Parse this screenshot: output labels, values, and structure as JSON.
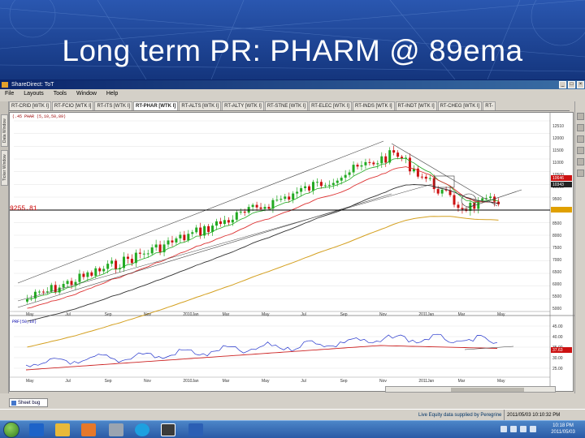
{
  "slide": {
    "title": "Long term PR: PHARM @ 89ema"
  },
  "window": {
    "title": "ShareDirect: ToT",
    "controls": [
      "_",
      "□",
      "×"
    ]
  },
  "menu": [
    "File",
    "Layouts",
    "Tools",
    "Window",
    "Help"
  ],
  "tabs": [
    {
      "label": "RT-CRID [WTK I]",
      "active": false
    },
    {
      "label": "RT-FCIO [WTK I]",
      "active": false
    },
    {
      "label": "RT-ITS [WTK I]",
      "active": false
    },
    {
      "label": "RT-PHAR [WTK I]",
      "active": true
    },
    {
      "label": "RT-ALTS [WTK I]",
      "active": false
    },
    {
      "label": "RT-ALTY [WTK I]",
      "active": false
    },
    {
      "label": "RT-STNE [WTK I]",
      "active": false
    },
    {
      "label": "RT-ELEC [WTK I]",
      "active": false
    },
    {
      "label": "RT-INDS [WTK I]",
      "active": false
    },
    {
      "label": "RT-INDT [WTK I]",
      "active": false
    },
    {
      "label": "RT-CHEG [WTK I]",
      "active": false
    },
    {
      "label": "RT-",
      "active": false
    }
  ],
  "left_dock_tabs": [
    "Data Window",
    "Ticker Window"
  ],
  "chart": {
    "header_info": "(.45 PHAR (5,10,50,89)",
    "indicator_info": "PRF(50,10)",
    "price_level_label": "9255.81",
    "x_labels": [
      "May",
      "Jul",
      "Sep",
      "Nov",
      "2010Jan",
      "Mar",
      "May",
      "Jul",
      "Sep",
      "Nov",
      "2011Jan",
      "Mar",
      "May"
    ],
    "price_axis_labels": [
      "12510",
      "12000",
      "11500",
      "11000",
      "10500",
      "10000",
      "9500",
      "9000",
      "8500",
      "8000",
      "7500",
      "7000",
      "6500",
      "6000",
      "5500",
      "5000"
    ],
    "price_axis_tags": [
      "10646",
      "10343"
    ],
    "indicator_axis_labels": [
      "45.00",
      "40.00",
      "35.00",
      "30.00",
      "25.00"
    ],
    "indicator_axis_tag": "37.63",
    "colors": {
      "up_candle": "#22aa22",
      "down_candle": "#cc1111",
      "ema_long": "#d4a020",
      "ema_mid": "#dd3333",
      "ema_short": "#333333",
      "channel": "#444444",
      "indicator": "#2233cc",
      "indicator_signal": "#cc2222",
      "level_line": "#000000"
    }
  },
  "sheet_tab": "Sheet bug",
  "status": {
    "text": "Live Equity data supplied by Peregrine",
    "datetime": "2011/05/03 10:10:32 PM"
  },
  "taskbar": {
    "time": "10:18 PM",
    "date": "2011/05/03",
    "apps": [
      "windows-start",
      "internet-explorer",
      "file-explorer",
      "media-player",
      "tools-app",
      "skype",
      "sharedirect-app",
      "word"
    ]
  }
}
